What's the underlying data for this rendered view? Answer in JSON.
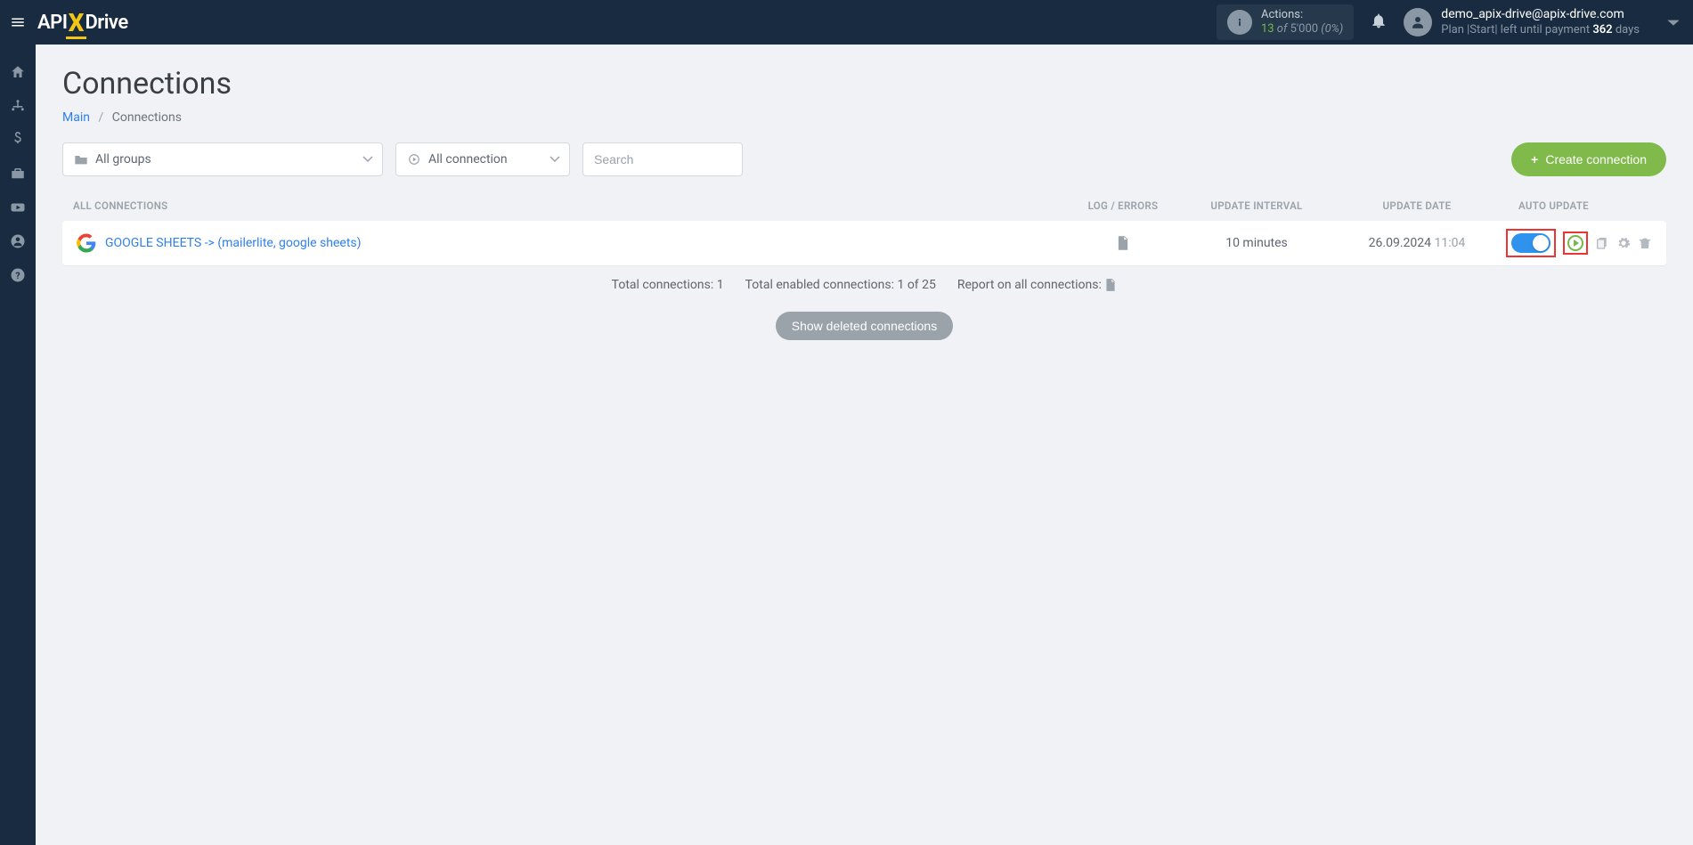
{
  "header": {
    "actions_label": "Actions:",
    "actions_count": "13",
    "actions_of": " of ",
    "actions_total": "5'000",
    "actions_pct": " (0%)",
    "user_email": "demo_apix-drive@apix-drive.com",
    "plan_prefix": "Plan |Start| left until payment ",
    "plan_days_num": "362",
    "plan_days_word": " days"
  },
  "page": {
    "title": "Connections",
    "breadcrumb_main": "Main",
    "breadcrumb_current": "Connections"
  },
  "filters": {
    "groups_label": "All groups",
    "conn_label": "All connection",
    "search_placeholder": "Search",
    "create_button": "Create connection"
  },
  "columns": {
    "all": "ALL CONNECTIONS",
    "log": "LOG / ERRORS",
    "interval": "UPDATE INTERVAL",
    "date": "UPDATE DATE",
    "auto": "AUTO UPDATE"
  },
  "row": {
    "name": "GOOGLE SHEETS -> (mailerlite, google sheets)",
    "interval": "10 minutes",
    "date": "26.09.2024",
    "time": "11:04"
  },
  "summary": {
    "total": "Total connections: 1",
    "enabled": "Total enabled connections: 1 of 25",
    "report": "Report on all connections:"
  },
  "show_deleted": "Show deleted connections"
}
